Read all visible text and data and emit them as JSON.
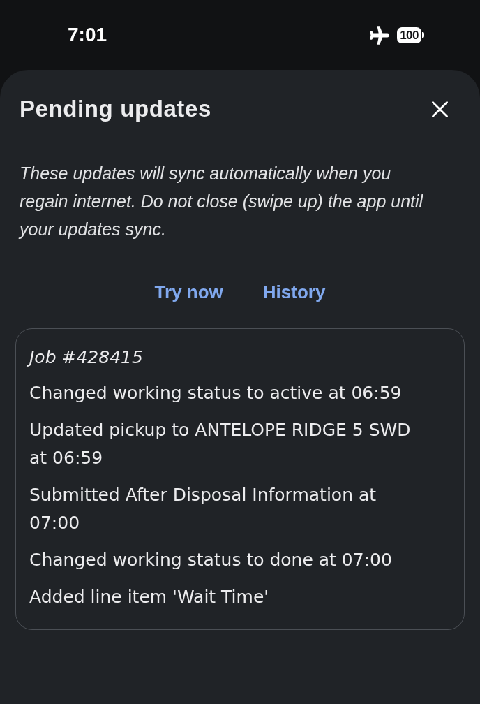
{
  "status_bar": {
    "time": "7:01",
    "battery_percent": "100"
  },
  "sheet": {
    "title": "Pending updates",
    "description": "These updates will sync automatically when you regain internet. Do not close (swipe up) the app until your updates sync.",
    "actions": [
      {
        "label": "Try now"
      },
      {
        "label": "History"
      }
    ],
    "job": {
      "title": "Job #428415",
      "updates": [
        "Changed working status to active at 06:59",
        "Updated pickup to ANTELOPE RIDGE 5 SWD at 06:59",
        "Submitted After Disposal Information at 07:00",
        "Changed working status to done at 07:00",
        "Added line item 'Wait Time'"
      ]
    }
  }
}
